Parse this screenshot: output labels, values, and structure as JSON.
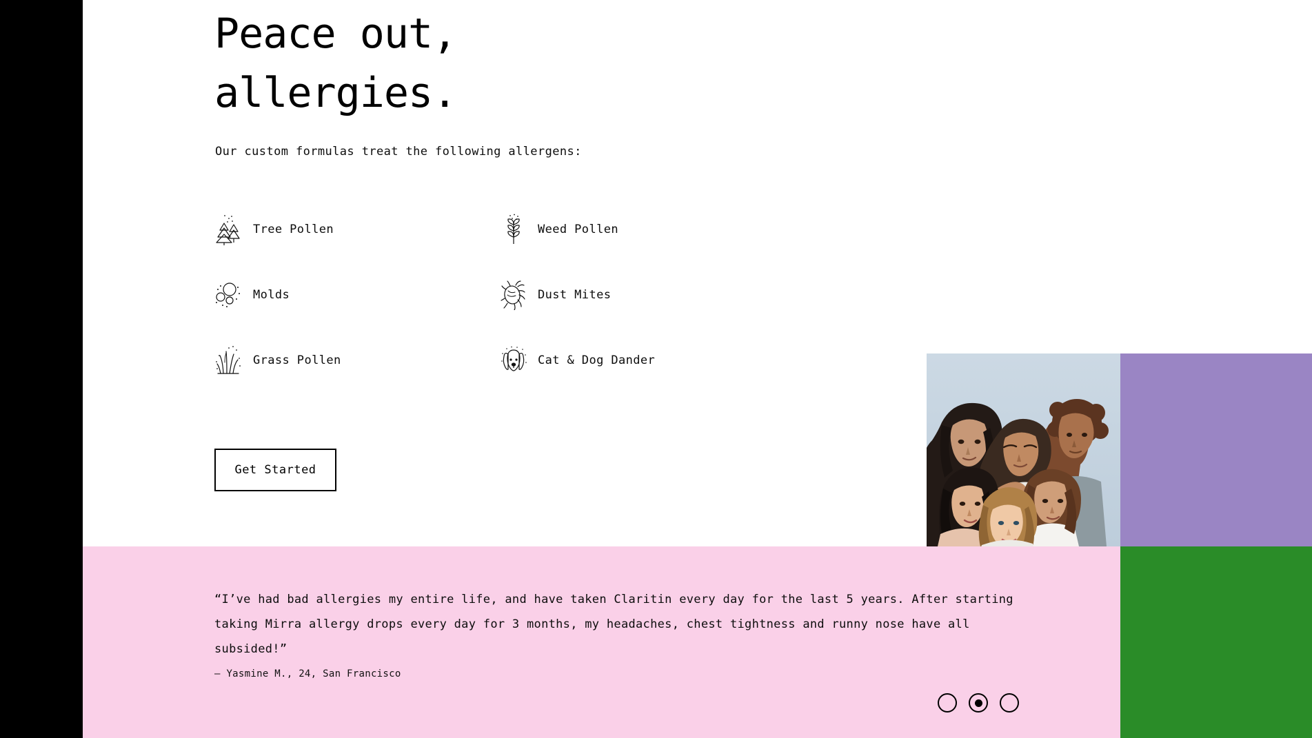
{
  "hero": {
    "headline": "Peace out,\nallergies.",
    "subtitle": "Our custom formulas treat the following allergens:",
    "cta_label": "Get Started"
  },
  "allergens": [
    {
      "label": "Tree Pollen",
      "icon": "tree-pollen-icon"
    },
    {
      "label": "Weed Pollen",
      "icon": "weed-pollen-icon"
    },
    {
      "label": "Molds",
      "icon": "molds-icon"
    },
    {
      "label": "Dust Mites",
      "icon": "dust-mites-icon"
    },
    {
      "label": "Grass Pollen",
      "icon": "grass-pollen-icon"
    },
    {
      "label": "Cat & Dog Dander",
      "icon": "cat-dog-dander-icon"
    }
  ],
  "testimonial": {
    "quote": "“I’ve had bad allergies my entire life, and have taken Claritin every day for the last 5 years. After starting taking Mirra allergy drops every day for 3 months, my headaches, chest tightness and runny nose have all subsided!”",
    "author": "– Yasmine M., 24, San Francisco",
    "dots": [
      {
        "label": "slide-1",
        "active": false
      },
      {
        "label": "slide-2",
        "active": true
      },
      {
        "label": "slide-3",
        "active": false
      }
    ]
  },
  "media": {
    "photo_alt": "group of young women photo"
  },
  "colors": {
    "black_bar": "#000000",
    "purple_block": "#9a85c4",
    "green_block": "#2a8c28",
    "pink_band": "#fad0e8",
    "text": "#0d0d0d",
    "page_background": "#ffffff"
  }
}
